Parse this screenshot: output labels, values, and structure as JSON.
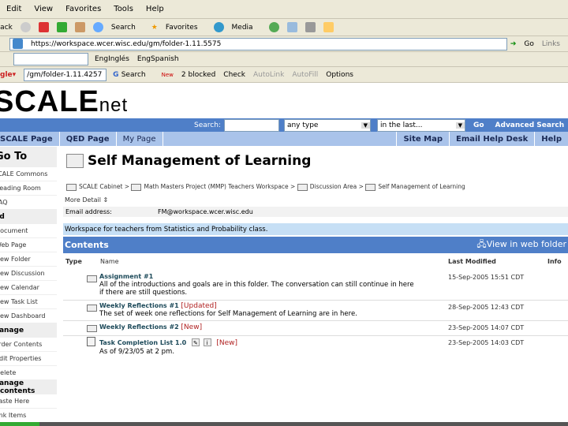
{
  "browser": {
    "menu": [
      "Edit",
      "View",
      "Favorites",
      "Tools",
      "Help"
    ],
    "toolbar": {
      "back": "Back",
      "search": "Search",
      "favorites": "Favorites",
      "media": "Media"
    },
    "address": {
      "url": "https://workspace.wcer.wisc.edu/gm/folder-1.11.5575",
      "go": "Go",
      "links": "Links"
    },
    "links_bar": {
      "eng": "EngInglés",
      "spa": "EngSpanish"
    },
    "google_bar": {
      "query": "/gm/folder-1.11.4257",
      "search": "Search",
      "new": "New",
      "blocked": "2 blocked",
      "check": "Check",
      "autolink": "AutoLink",
      "autofill": "AutoFill",
      "options": "Options"
    }
  },
  "logo": {
    "text": "SCALE",
    "suffix": "net"
  },
  "searchbar": {
    "label": "Search:",
    "type": "any type",
    "time": "in the last...",
    "go": "Go",
    "advanced": "Advanced Search"
  },
  "nav": {
    "left": [
      "SCALE Page",
      "QED Page",
      "My Page"
    ],
    "right": [
      "Site Map",
      "Email Help Desk",
      "Help"
    ]
  },
  "sidebar": [
    {
      "label": "Go To",
      "header": true
    },
    {
      "label": "SCALE Commons"
    },
    {
      "label": "Reading Room"
    },
    {
      "label": "FAQ"
    },
    {
      "label": "Add",
      "header": true
    },
    {
      "label": "Document"
    },
    {
      "label": "Web Page"
    },
    {
      "label": "New Folder"
    },
    {
      "label": "New Discussion"
    },
    {
      "label": "New Calendar"
    },
    {
      "label": "New Task List"
    },
    {
      "label": "New Dashboard"
    },
    {
      "label": "Manage",
      "header": true
    },
    {
      "label": "Order Contents"
    },
    {
      "label": "Edit Properties"
    },
    {
      "label": "Delete"
    },
    {
      "label": "Manage contents",
      "header": true
    },
    {
      "label": "Paste Here"
    },
    {
      "label": "Link Items"
    }
  ],
  "page": {
    "title": "Self Management of Learning",
    "breadcrumb": [
      "SCALE Cabinet",
      "Math Masters Project (MMP) Teachers Workspace",
      "Discussion Area",
      "Self Management of Learning"
    ],
    "more_detail": "More Detail",
    "email_label": "Email address:",
    "email_value": "FM@workspace.wcer.wisc.edu",
    "description": "Workspace for teachers from Statistics and Probability class.",
    "contents_title": "Contents",
    "web_folder": "View in web folder",
    "columns": [
      "Type",
      "Name",
      "Last Modified",
      "Info"
    ],
    "items": [
      {
        "name": "Assignment #1",
        "tag": "",
        "desc": "All of the introductions and goals are in this folder.  The conversation can still continue in here if there are still questions.",
        "date": "15-Sep-2005 15:51 CDT"
      },
      {
        "name": "Weekly Reflections #1",
        "tag": "[Updated]",
        "desc": "The set of week one reflections for Self Management of Learning are in here.",
        "date": "28-Sep-2005 12:43 CDT"
      },
      {
        "name": "Weekly Reflections #2",
        "tag": "[New]",
        "desc": "",
        "date": "23-Sep-2005 14:07 CDT"
      },
      {
        "name": "Task Completion List 1.0",
        "tag": "[New]",
        "desc": "As of 9/23/05 at 2 pm.",
        "date": "23-Sep-2005 14:03 CDT"
      }
    ]
  }
}
